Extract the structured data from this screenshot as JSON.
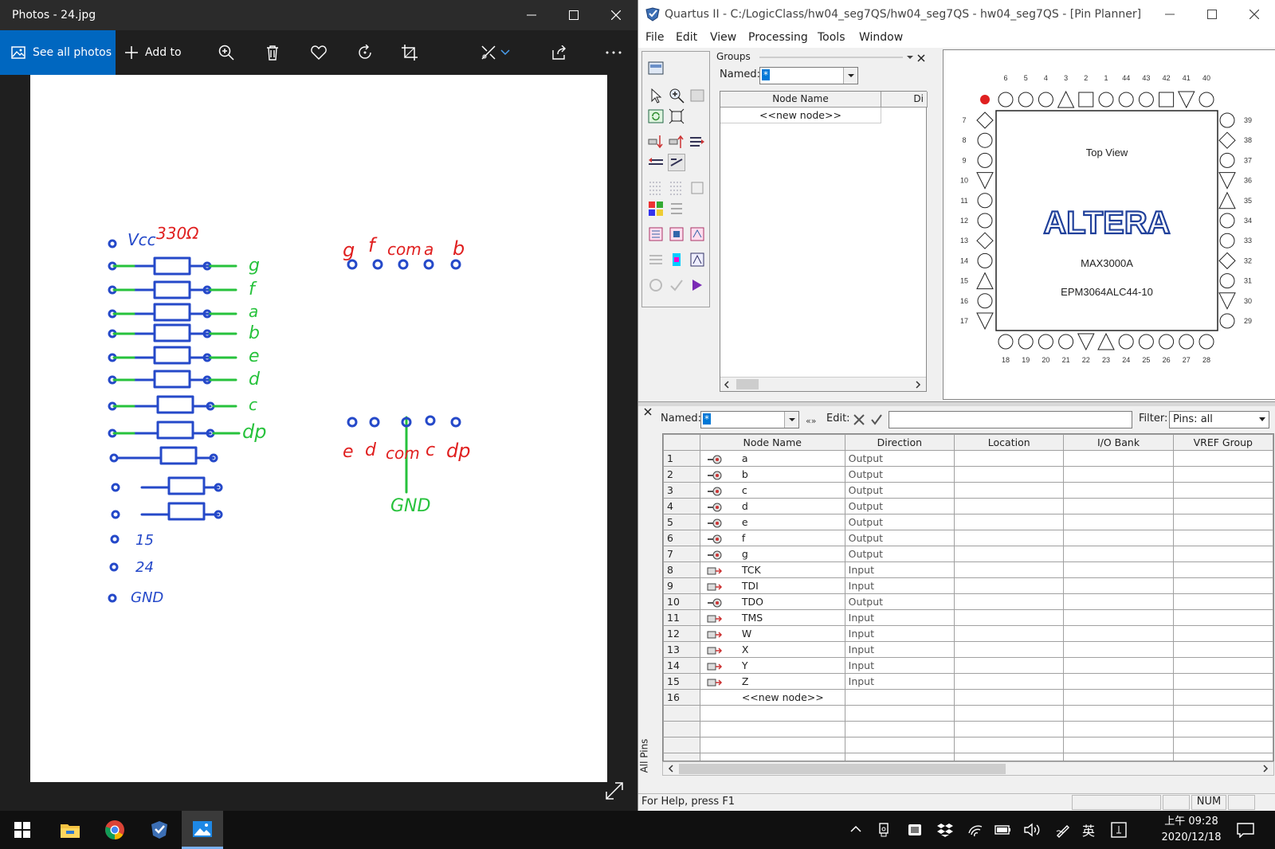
{
  "photos": {
    "title": "Photos - 24.jpg",
    "see_all": "See all photos",
    "add_to": "Add to",
    "sketch": {
      "vcc": "Vcc",
      "resistor": "330Ω",
      "left_segments": [
        "g",
        "f",
        "a",
        "b",
        "e",
        "d",
        "c",
        "dp"
      ],
      "pin_15": "15",
      "pin_24": "24",
      "gnd_left": "GND",
      "top_labels": [
        "g",
        "f",
        "com",
        "a",
        "b"
      ],
      "bottom_labels": [
        "e",
        "d",
        "com",
        "c",
        "dp"
      ],
      "gnd_right": "GND"
    }
  },
  "quartus": {
    "title": "Quartus II - C:/LogicClass/hw04_seg7QS/hw04_seg7QS - hw04_seg7QS - [Pin Planner]",
    "menu": [
      "File",
      "Edit",
      "View",
      "Processing",
      "Tools",
      "Window"
    ],
    "groups": {
      "label": "Groups",
      "named_label": "Named:",
      "named_value": "*",
      "col_node": "Node Name",
      "col_di": "Di",
      "new_node": "<<new node>>"
    },
    "pinview": {
      "top_view": "Top View",
      "logo": "ALTERA",
      "device_family": "MAX3000A",
      "device": "EPM3064ALC44-10",
      "top_pins": [
        "6",
        "5",
        "4",
        "3",
        "2",
        "1",
        "44",
        "43",
        "42",
        "41",
        "40"
      ],
      "bottom_pins": [
        "18",
        "19",
        "20",
        "21",
        "22",
        "23",
        "24",
        "25",
        "26",
        "27",
        "28"
      ],
      "left_pins": [
        "7",
        "8",
        "9",
        "10",
        "11",
        "12",
        "13",
        "14",
        "15",
        "16",
        "17"
      ],
      "right_pins": [
        "39",
        "38",
        "37",
        "36",
        "35",
        "34",
        "33",
        "32",
        "31",
        "30",
        "29"
      ]
    },
    "filterbar": {
      "named_label": "Named:",
      "named_value": "*",
      "edit_label": "Edit:",
      "filter_label": "Filter:",
      "filter_value": "Pins: all"
    },
    "side_tab": "All Pins",
    "columns": [
      "Node Name",
      "Direction",
      "Location",
      "I/O Bank",
      "VREF Group"
    ],
    "rows": [
      {
        "n": "1",
        "name": "a",
        "dir": "Output",
        "type": "out"
      },
      {
        "n": "2",
        "name": "b",
        "dir": "Output",
        "type": "out"
      },
      {
        "n": "3",
        "name": "c",
        "dir": "Output",
        "type": "out"
      },
      {
        "n": "4",
        "name": "d",
        "dir": "Output",
        "type": "out"
      },
      {
        "n": "5",
        "name": "e",
        "dir": "Output",
        "type": "out"
      },
      {
        "n": "6",
        "name": "f",
        "dir": "Output",
        "type": "out"
      },
      {
        "n": "7",
        "name": "g",
        "dir": "Output",
        "type": "out"
      },
      {
        "n": "8",
        "name": "TCK",
        "dir": "Input",
        "type": "in"
      },
      {
        "n": "9",
        "name": "TDI",
        "dir": "Input",
        "type": "in"
      },
      {
        "n": "10",
        "name": "TDO",
        "dir": "Output",
        "type": "out"
      },
      {
        "n": "11",
        "name": "TMS",
        "dir": "Input",
        "type": "in"
      },
      {
        "n": "12",
        "name": "W",
        "dir": "Input",
        "type": "in"
      },
      {
        "n": "13",
        "name": "X",
        "dir": "Input",
        "type": "in"
      },
      {
        "n": "14",
        "name": "Y",
        "dir": "Input",
        "type": "in"
      },
      {
        "n": "15",
        "name": "Z",
        "dir": "Input",
        "type": "in"
      },
      {
        "n": "16",
        "name": "<<new node>>",
        "dir": "",
        "type": "none"
      }
    ],
    "status": "For Help, press F1",
    "num": "NUM"
  },
  "taskbar": {
    "ime": "英",
    "time": "上午 09:28",
    "date": "2020/12/18"
  }
}
